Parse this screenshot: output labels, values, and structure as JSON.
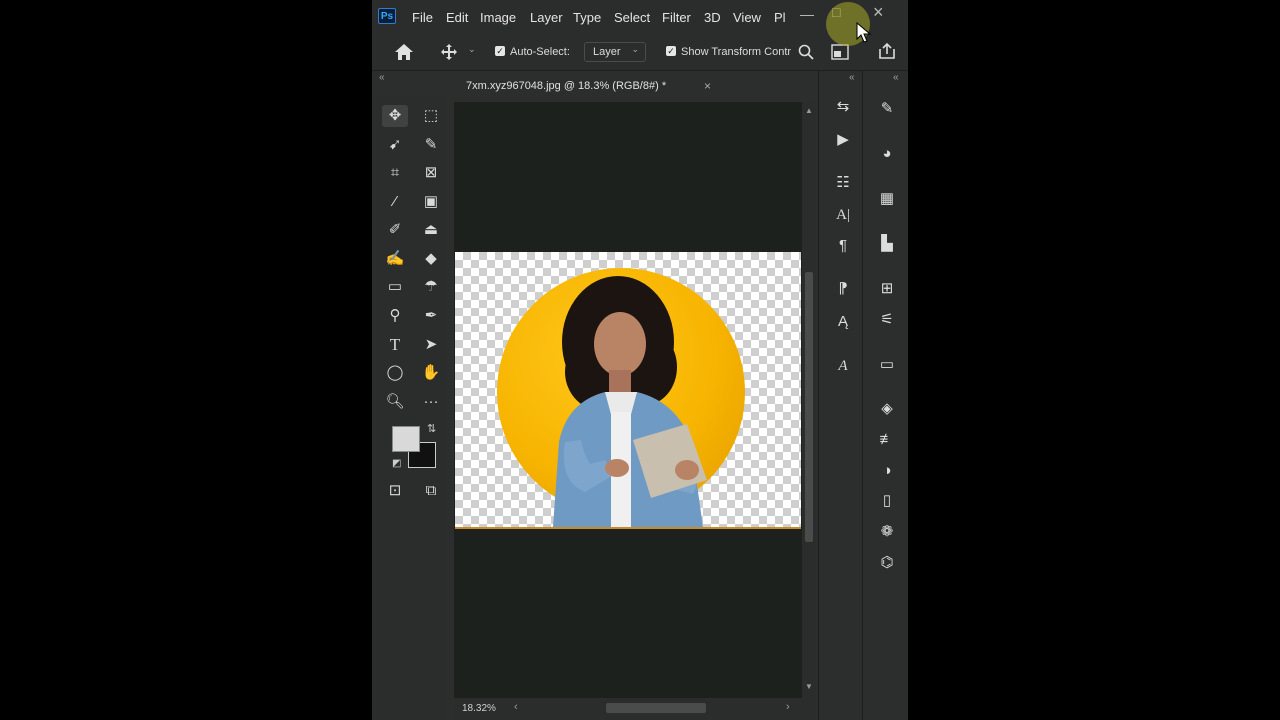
{
  "app": {
    "logo": "Ps"
  },
  "menu": [
    "File",
    "Edit",
    "Image",
    "Layer",
    "Type",
    "Select",
    "Filter",
    "3D",
    "View",
    "Pl"
  ],
  "window_controls": {
    "minimize": "—",
    "maximize": "□",
    "close": "×"
  },
  "options_bar": {
    "auto_select_label": "Auto-Select:",
    "auto_select_checked": true,
    "auto_select_target": "Layer",
    "show_transform_label": "Show Transform Contr",
    "show_transform_checked": true
  },
  "document": {
    "tab_title": "7xm.xyz967048.jpg @ 18.3% (RGB/8#) *",
    "close_glyph": "×",
    "circle_color": "#f7b400"
  },
  "status": {
    "zoom": "18.32%"
  },
  "toolbar_tools": [
    "move-tool",
    "marquee-tool",
    "lasso-tool",
    "quick-selection-tool",
    "crop-tool",
    "frame-tool",
    "eyedropper-tool",
    "spot-healing-tool",
    "brush-tool",
    "clone-stamp-tool",
    "history-brush-tool",
    "eraser-tool",
    "gradient-tool",
    "blur-tool",
    "dodge-tool",
    "pen-tool",
    "type-tool",
    "path-selection-tool",
    "ellipse-tool",
    "hand-tool",
    "zoom-tool",
    "more-tools"
  ],
  "colors": {
    "foreground": "#d9d9d9",
    "background": "#111111",
    "accent": "#31a8ff"
  }
}
